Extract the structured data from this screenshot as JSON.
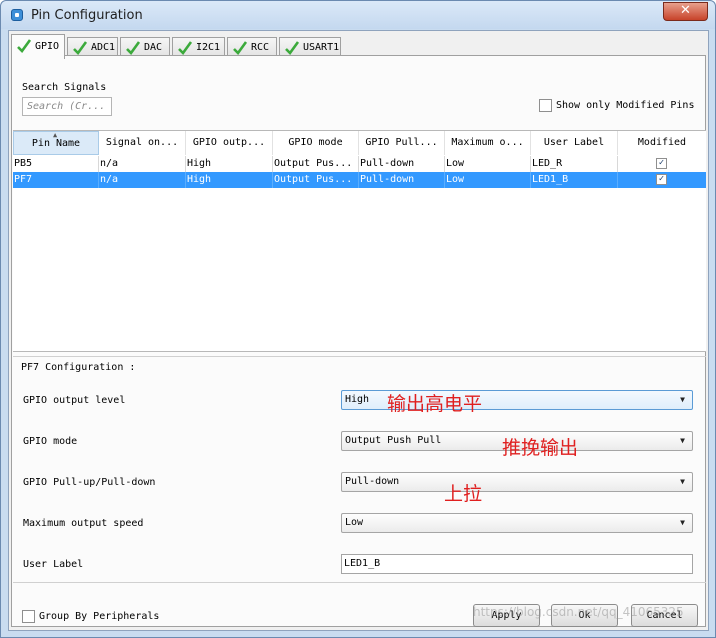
{
  "window": {
    "title": "Pin Configuration",
    "close_glyph": "✕"
  },
  "tabs": [
    {
      "label": "GPIO",
      "icon": "check-icon",
      "active": true
    },
    {
      "label": "ADC1",
      "icon": "check-icon"
    },
    {
      "label": "DAC",
      "icon": "check-icon"
    },
    {
      "label": "I2C1",
      "icon": "check-icon"
    },
    {
      "label": "RCC",
      "icon": "check-icon"
    },
    {
      "label": "USART1",
      "icon": "check-icon"
    }
  ],
  "search": {
    "label": "Search Signals",
    "placeholder": "Search (Cr..."
  },
  "modified_only": {
    "label": "Show only Modified Pins",
    "checked": false
  },
  "table": {
    "columns": [
      "Pin Name",
      "Signal on...",
      "GPIO outp...",
      "GPIO mode",
      "GPIO Pull...",
      "Maximum o...",
      "User Label",
      "Modified"
    ],
    "sort_glyph": "▲",
    "rows": [
      {
        "pin": "PB5",
        "signal": "n/a",
        "output": "High",
        "mode": "Output Pus...",
        "pull": "Pull-down",
        "speed": "Low",
        "label": "LED_R",
        "modified": "✓",
        "selected": false
      },
      {
        "pin": "PF7",
        "signal": "n/a",
        "output": "High",
        "mode": "Output Pus...",
        "pull": "Pull-down",
        "speed": "Low",
        "label": "LED1_B",
        "modified": "✓",
        "selected": true
      }
    ]
  },
  "config": {
    "title": "PF7 Configuration :",
    "output_level": {
      "label": "GPIO output level",
      "value": "High"
    },
    "mode": {
      "label": "GPIO mode",
      "value": "Output Push Pull"
    },
    "pull": {
      "label": "GPIO Pull-up/Pull-down",
      "value": "Pull-down"
    },
    "speed": {
      "label": "Maximum output speed",
      "value": "Low"
    },
    "user_label": {
      "label": "User Label",
      "value": "LED1_B"
    },
    "dropdown_glyph": "▼"
  },
  "annotations": {
    "output_high": "输出高电平",
    "push_pull": "推挽输出",
    "pull_up": "上拉"
  },
  "footer": {
    "group_by": "Group By Peripherals",
    "apply": "Apply",
    "ok": "Ok",
    "cancel": "Cancel",
    "watermark": "https://blog.csdn.net/qq_41065325"
  },
  "colors": {
    "selection": "#3399ff",
    "annotation": "#e02020",
    "check": "#3caa3c"
  }
}
